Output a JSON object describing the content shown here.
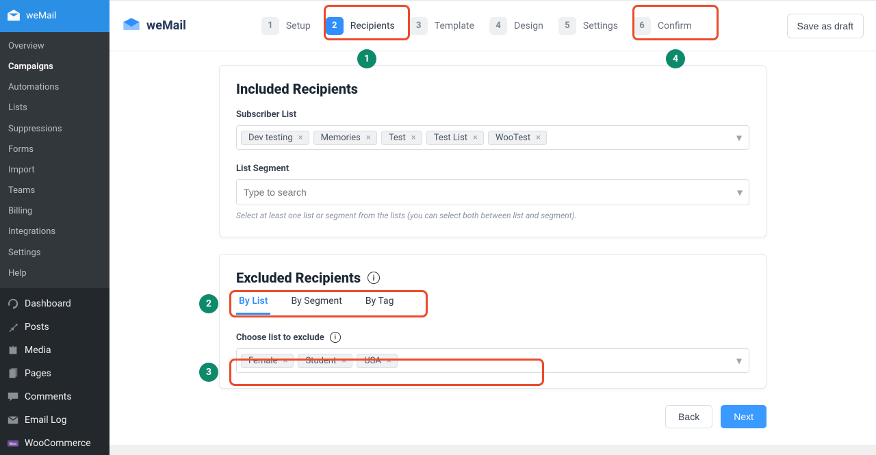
{
  "sidebar": {
    "brand": "weMail",
    "submenu": [
      {
        "label": "Overview",
        "active": false
      },
      {
        "label": "Campaigns",
        "active": true
      },
      {
        "label": "Automations",
        "active": false
      },
      {
        "label": "Lists",
        "active": false
      },
      {
        "label": "Suppressions",
        "active": false
      },
      {
        "label": "Forms",
        "active": false
      },
      {
        "label": "Import",
        "active": false
      },
      {
        "label": "Teams",
        "active": false
      },
      {
        "label": "Billing",
        "active": false
      },
      {
        "label": "Integrations",
        "active": false
      },
      {
        "label": "Settings",
        "active": false
      },
      {
        "label": "Help",
        "active": false
      }
    ],
    "main_nav": [
      {
        "icon": "dashboard-icon",
        "label": "Dashboard"
      },
      {
        "icon": "pin-icon",
        "label": "Posts"
      },
      {
        "icon": "media-icon",
        "label": "Media"
      },
      {
        "icon": "pages-icon",
        "label": "Pages"
      },
      {
        "icon": "comments-icon",
        "label": "Comments"
      },
      {
        "icon": "email-icon",
        "label": "Email Log"
      },
      {
        "icon": "woo-icon",
        "label": "WooCommerce"
      }
    ]
  },
  "brand_text": "weMail",
  "stepper": [
    {
      "num": "1",
      "label": "Setup"
    },
    {
      "num": "2",
      "label": "Recipients",
      "active": true
    },
    {
      "num": "3",
      "label": "Template"
    },
    {
      "num": "4",
      "label": "Design"
    },
    {
      "num": "5",
      "label": "Settings"
    },
    {
      "num": "6",
      "label": "Confirm"
    }
  ],
  "save_draft": "Save as draft",
  "included": {
    "title": "Included Recipients",
    "sub_list_label": "Subscriber List",
    "sub_list_chips": [
      "Dev testing",
      "Memories",
      "Test",
      "Test List",
      "WooTest"
    ],
    "segment_label": "List Segment",
    "segment_placeholder": "Type to search",
    "helper": "Select at least one list or segment from the lists (you can select both between list and segment)."
  },
  "excluded": {
    "title": "Excluded Recipients",
    "tabs": [
      {
        "label": "By List",
        "active": true
      },
      {
        "label": "By Segment",
        "active": false
      },
      {
        "label": "By Tag",
        "active": false
      }
    ],
    "choose_label": "Choose list to exclude",
    "chips": [
      "Female",
      "Student",
      "USA"
    ]
  },
  "buttons": {
    "back": "Back",
    "next": "Next"
  },
  "annotations": {
    "badge1": "1",
    "badge2": "2",
    "badge3": "3",
    "badge4": "4"
  }
}
